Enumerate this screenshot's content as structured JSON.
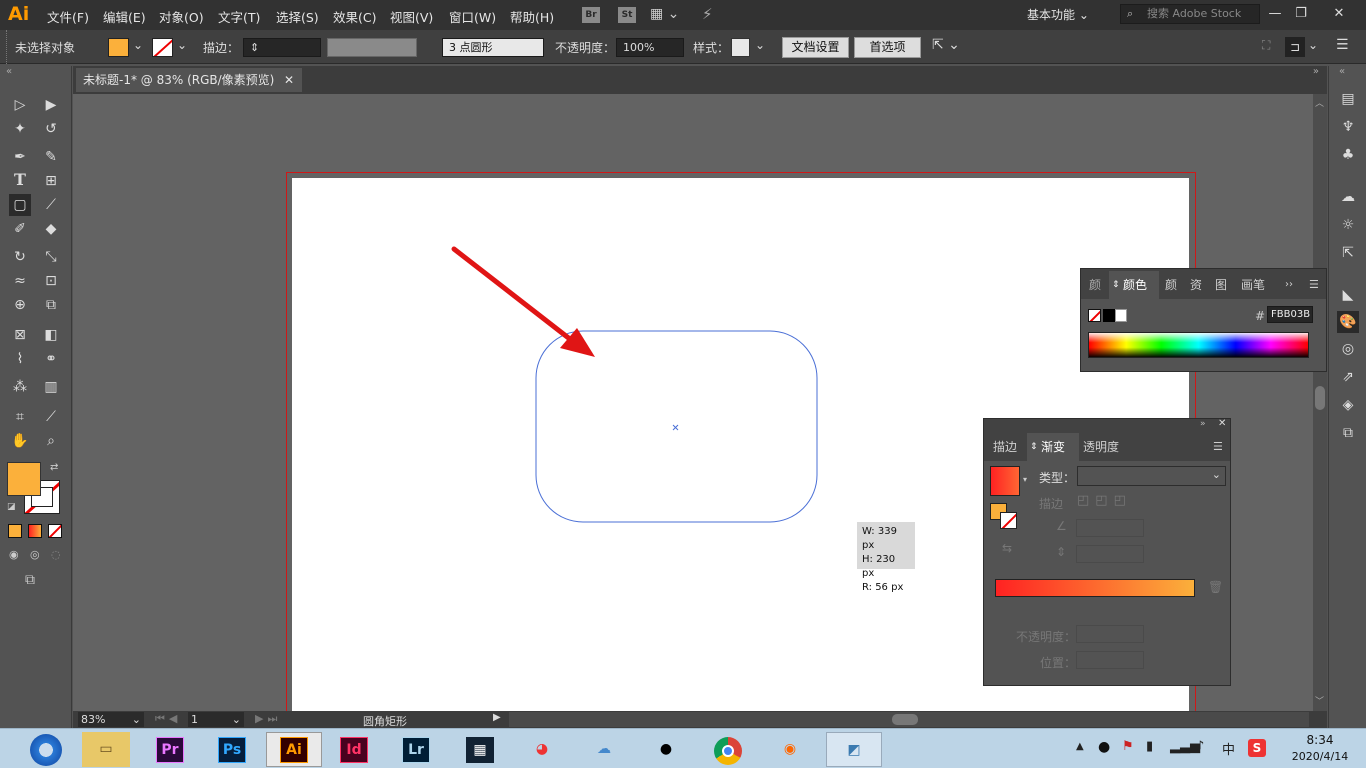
{
  "app": {
    "logo": "Ai"
  },
  "menu": [
    "文件(F)",
    "编辑(E)",
    "对象(O)",
    "文字(T)",
    "选择(S)",
    "效果(C)",
    "视图(V)",
    "窗口(W)",
    "帮助(H)"
  ],
  "menu_buttons": {
    "br": "Br",
    "st": "St"
  },
  "workspace": {
    "label": "基本功能"
  },
  "search": {
    "placeholder": "搜索 Adobe Stock"
  },
  "control": {
    "no_selection": "未选择对象",
    "stroke_label": "描边：",
    "brush": "3 点圆形",
    "opacity_label": "不透明度：",
    "opacity_value": "100%",
    "style_label": "样式：",
    "doc_setup": "文档设置",
    "prefs": "首选项"
  },
  "document": {
    "tab_title": "未标题-1* @ 83% (RGB/像素预览)"
  },
  "tooltip": {
    "w": "W: 339 px",
    "h": "H: 230 px",
    "r": "R: 56 px"
  },
  "color_panel": {
    "tabs": [
      "颜色",
      "颜色",
      "颜色",
      "资源",
      "图形",
      "画笔"
    ],
    "active_tab": "颜色",
    "hex_label": "#",
    "hex_value": "FBB03B"
  },
  "gradient_panel": {
    "tabs": [
      "描边",
      "渐变",
      "透明度"
    ],
    "active_tab": "渐变",
    "type_label": "类型：",
    "stroke_label": "描边",
    "opacity_label": "不透明度：",
    "position_label": "位置："
  },
  "status": {
    "zoom": "83%",
    "page": "1",
    "tool": "圆角矩形"
  },
  "taskbar": {
    "apps": [
      "Pr",
      "Ps",
      "Ai",
      "Id",
      "Lr"
    ],
    "time": "8:34",
    "date": "2020/4/14",
    "ime": "中"
  },
  "colors": {
    "fill": "#fbb03b",
    "accent": "#ff9a00",
    "bleed": "#d01818",
    "shape_stroke": "#4a6fd6"
  }
}
